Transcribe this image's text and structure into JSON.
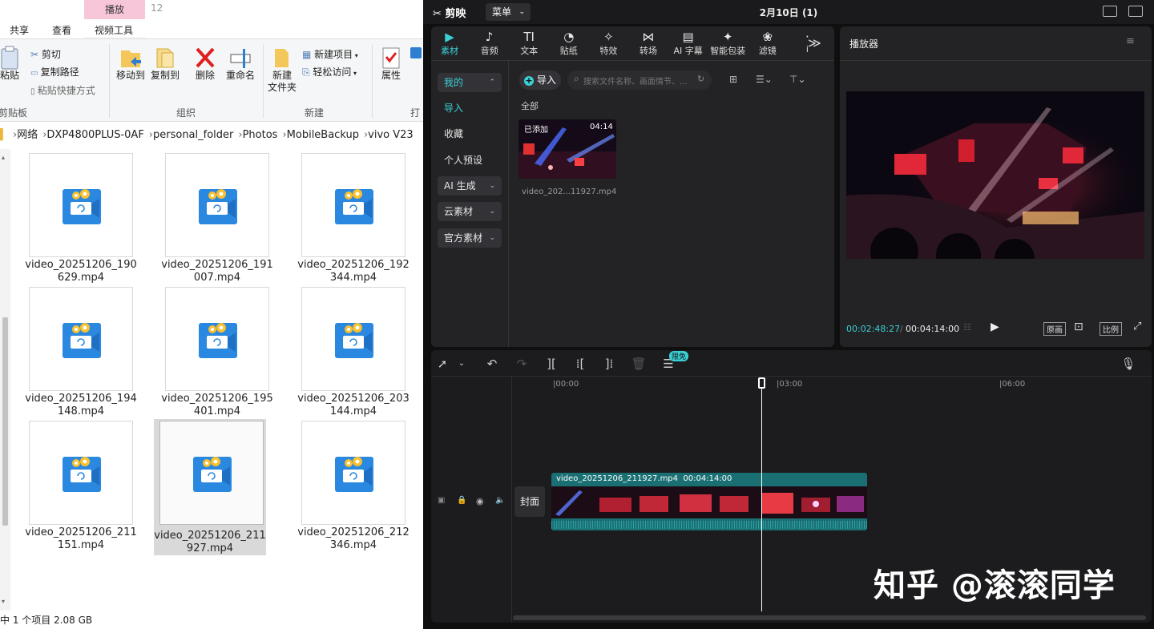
{
  "explorer": {
    "ribbon_tabs": [
      "共享",
      "查看",
      "视频工具"
    ],
    "context_tab": "播放",
    "context_number": "12",
    "clipboard": {
      "paste": "粘贴",
      "cut": "剪切",
      "copy_path": "复制路径",
      "paste_shortcut": "粘贴快捷方式",
      "group": "剪贴板"
    },
    "organize": {
      "move_to": "移动到",
      "copy_to": "复制到",
      "delete": "删除",
      "rename": "重命名",
      "group": "组织"
    },
    "new": {
      "new_folder_line1": "新建",
      "new_folder_line2": "文件夹",
      "new_item": "新建项目",
      "easy_access": "轻松访问",
      "group": "新建"
    },
    "open": {
      "properties": "属性",
      "group": "打"
    },
    "address": [
      "网络",
      "DXP4800PLUS-0AF",
      "personal_folder",
      "Photos",
      "MobileBackup",
      "vivo V23"
    ],
    "files": [
      {
        "line1": "video_20251206_190",
        "line2": "629.mp4"
      },
      {
        "line1": "video_20251206_191",
        "line2": "007.mp4"
      },
      {
        "line1": "video_20251206_192",
        "line2": "344.mp4"
      },
      {
        "line1": "video_20251206_194",
        "line2": "148.mp4"
      },
      {
        "line1": "video_20251206_195",
        "line2": "401.mp4"
      },
      {
        "line1": "video_20251206_203",
        "line2": "144.mp4"
      },
      {
        "line1": "video_20251206_211",
        "line2": "151.mp4"
      },
      {
        "line1": "video_20251206_211",
        "line2": "927.mp4"
      },
      {
        "line1": "video_20251206_212",
        "line2": "346.mp4"
      }
    ],
    "status": "中 1 个项目  2.08 GB"
  },
  "capcut": {
    "app_name": "剪映",
    "menu": "菜单",
    "project_title": "2月10日 (1)",
    "toolbar": [
      {
        "label": "素材",
        "icon": "media-icon"
      },
      {
        "label": "音频",
        "icon": "audio-icon"
      },
      {
        "label": "文本",
        "icon": "text-icon"
      },
      {
        "label": "贴纸",
        "icon": "sticker-icon"
      },
      {
        "label": "特效",
        "icon": "effects-icon"
      },
      {
        "label": "转场",
        "icon": "transition-icon"
      },
      {
        "label": "AI 字幕",
        "icon": "ai-caption-icon"
      },
      {
        "label": "智能包装",
        "icon": "smart-pack-icon"
      },
      {
        "label": "滤镜",
        "icon": "filter-icon"
      },
      {
        "label": "i",
        "icon": "adjust-icon"
      }
    ],
    "sidebar": {
      "mine": "我的",
      "import": "导入",
      "favorites": "收藏",
      "presets": "个人预设",
      "ai_gen": "AI 生成",
      "cloud": "云素材",
      "official": "官方素材"
    },
    "media": {
      "import_button": "导入",
      "search_placeholder": "搜索文件名称、画面情节、...",
      "filter_all": "全部",
      "clip_badge": "已添加",
      "clip_duration": "04:14",
      "clip_name": "video_202...11927.mp4"
    },
    "player": {
      "title": "播放器",
      "current_time": "00:02:48:27",
      "total_time": "00:04:14:00",
      "original": "原画",
      "ratio": "比例"
    },
    "timeline": {
      "free_badge": "限免",
      "ruler": [
        "00:00",
        "03:00",
        "06:00"
      ],
      "cover": "封面",
      "clip_name": "video_20251206_211927.mp4",
      "clip_duration": "00:04:14:00"
    }
  },
  "watermark": "知乎 @滚滚同学",
  "colors": {
    "accent": "#3ad0d6",
    "context_tab": "#f7c6d8",
    "clip_track": "#1a6f73"
  }
}
